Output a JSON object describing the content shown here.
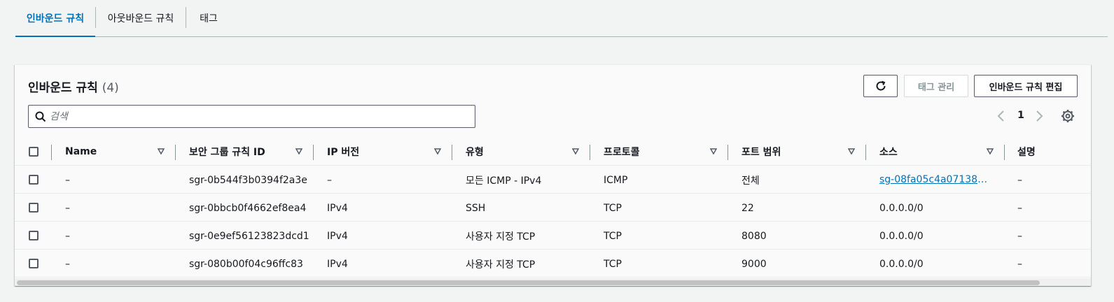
{
  "tabs": {
    "inbound": "인바운드 규칙",
    "outbound": "아웃바운드 규칙",
    "tags": "태그"
  },
  "panel": {
    "title": "인바운드 규칙",
    "count": "(4)",
    "refresh_icon": "refresh-icon",
    "manage_tags_label": "태그 관리",
    "edit_rules_label": "인바운드 규칙 편집",
    "search_placeholder": "검색",
    "search_value": "",
    "page_number": "1"
  },
  "table": {
    "columns": {
      "name": "Name",
      "rule_id": "보안 그룹 규칙 ID",
      "ip_version": "IP 버전",
      "type": "유형",
      "protocol": "프로토콜",
      "port_range": "포트 범위",
      "source": "소스",
      "description": "설명"
    },
    "rows": [
      {
        "name": "–",
        "rule_id": "sgr-0b544f3b0394f2a3e",
        "ip_version": "–",
        "type": "모든 ICMP - IPv4",
        "protocol": "ICMP",
        "port_range": "전체",
        "source": "sg-08fa05c4a07138dd...",
        "description": "–"
      },
      {
        "name": "–",
        "rule_id": "sgr-0bbcb0f4662ef8ea4",
        "ip_version": "IPv4",
        "type": "SSH",
        "protocol": "TCP",
        "port_range": "22",
        "source": "0.0.0.0/0",
        "description": "–"
      },
      {
        "name": "–",
        "rule_id": "sgr-0e9ef56123823dcd1",
        "ip_version": "IPv4",
        "type": "사용자 지정 TCP",
        "protocol": "TCP",
        "port_range": "8080",
        "source": "0.0.0.0/0",
        "description": "–"
      },
      {
        "name": "–",
        "rule_id": "sgr-080b00f04c96ffc83",
        "ip_version": "IPv4",
        "type": "사용자 지정 TCP",
        "protocol": "TCP",
        "port_range": "9000",
        "source": "0.0.0.0/0",
        "description": "–"
      }
    ]
  },
  "colors": {
    "accent": "#0073bb",
    "text": "#16191f",
    "background": "#f2f3f3"
  }
}
